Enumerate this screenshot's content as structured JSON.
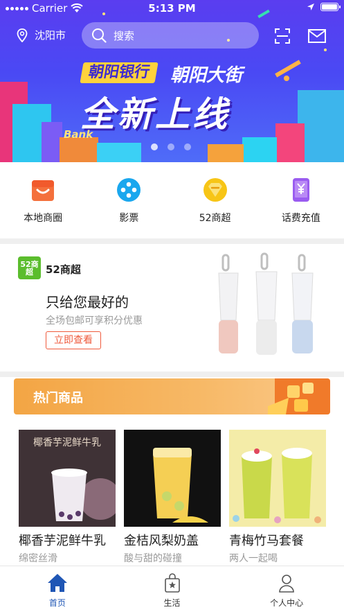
{
  "status_bar": {
    "carrier": "Carrier",
    "time": "5:13 PM"
  },
  "header": {
    "city": "沈阳市",
    "search_placeholder": "搜索",
    "icons": [
      "location-pin-icon",
      "search-icon",
      "scan-icon",
      "mail-icon"
    ]
  },
  "banner": {
    "badge_text": "朝阳银行",
    "sub_text": "朝阳大街",
    "main_text": "全新上线",
    "bank_text": "Bank",
    "page_count": 3,
    "active_page": 0
  },
  "categories": [
    {
      "label": "本地商圈",
      "icon": "shopping-bag-icon",
      "color": "#f15a2c"
    },
    {
      "label": "影票",
      "icon": "film-reel-icon",
      "color": "#1aa7ee"
    },
    {
      "label": "52商超",
      "icon": "diamond-icon",
      "color": "#f7c516"
    },
    {
      "label": "话费充值",
      "icon": "phone-yuan-icon",
      "color": "#9a5cf0"
    }
  ],
  "promo": {
    "logo_text": "52商超",
    "brand": "52商超",
    "title": "只给您最好的",
    "description": "全场包邮可享积分优惠",
    "button": "立即查看"
  },
  "hot": {
    "title": "热门商品",
    "items": [
      {
        "name": "椰香芋泥鲜牛乳",
        "subtitle": "绵密丝滑",
        "image_caption": "椰香芋泥鲜牛乳"
      },
      {
        "name": "金桔风梨奶盖",
        "subtitle": "酸与甜的碰撞",
        "image_caption": ""
      },
      {
        "name": "青梅竹马套餐",
        "subtitle": "两人一起喝",
        "image_caption": ""
      }
    ]
  },
  "tabbar": {
    "tabs": [
      {
        "label": "首页",
        "icon": "home-icon",
        "active": true
      },
      {
        "label": "生活",
        "icon": "shopping-bag-star-icon",
        "active": false
      },
      {
        "label": "个人中心",
        "icon": "person-icon",
        "active": false
      }
    ]
  },
  "colors": {
    "banner_start": "#5a3df0",
    "banner_end": "#4f6cf8",
    "accent_red": "#ef5a3c",
    "hot_banner": "#f3a544",
    "tab_active": "#1f56b5"
  }
}
